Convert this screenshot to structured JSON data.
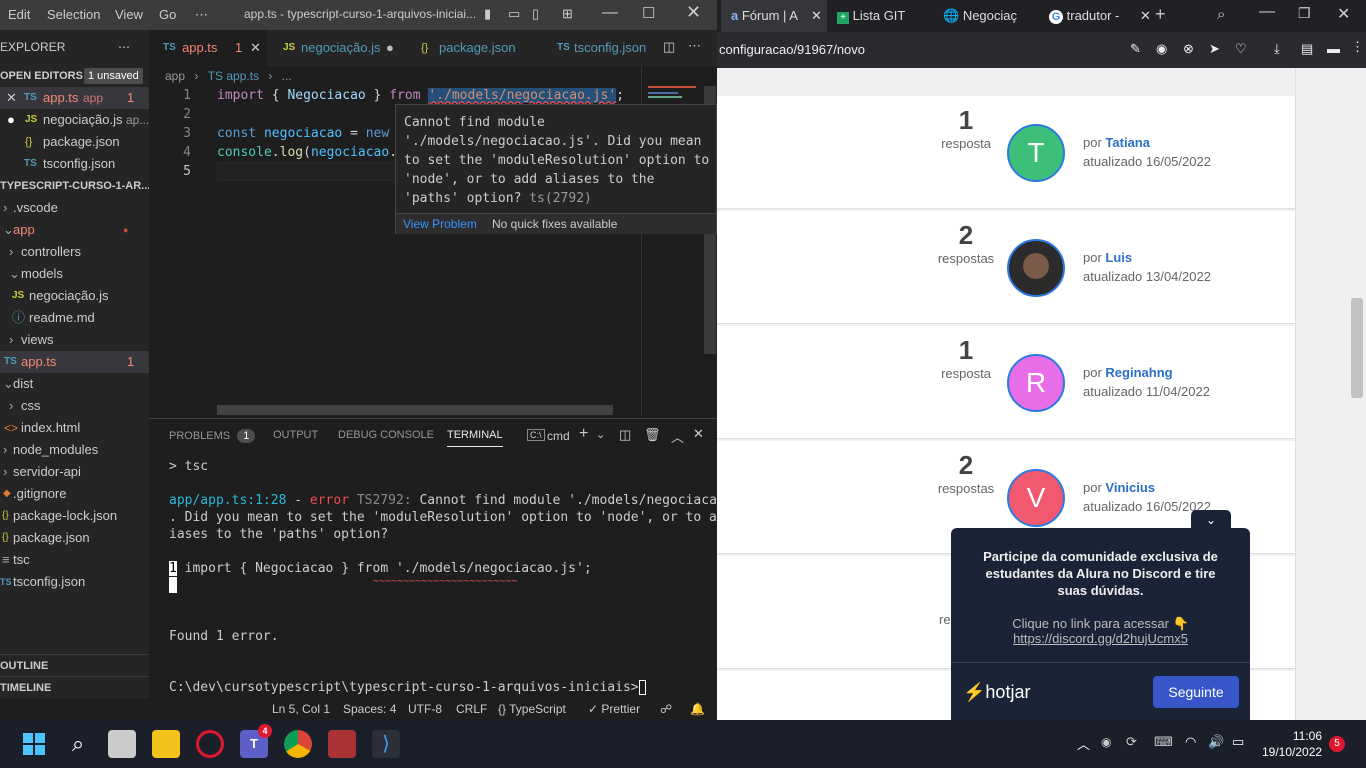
{
  "vscode": {
    "menu": [
      "Edit",
      "Selection",
      "View",
      "Go",
      "⋯"
    ],
    "window_title": "app.ts - typescript-curso-1-arquivos-iniciai...",
    "explorer_title": "EXPLORER",
    "open_editors": {
      "label": "OPEN EDITORS",
      "badge": "1 unsaved",
      "items": [
        {
          "icon": "TS",
          "name": "app.ts",
          "extra": "app",
          "count": "1"
        },
        {
          "icon": "JS",
          "name": "negociação.js",
          "extra": "ap..."
        },
        {
          "icon": "{}",
          "name": "package.json"
        },
        {
          "icon": "TS",
          "name": "tsconfig.json"
        }
      ]
    },
    "project_label": "TYPESCRIPT-CURSO-1-AR...",
    "tree": [
      {
        "name": ".vscode",
        "icon": "chevron-right"
      },
      {
        "name": "app",
        "icon": "chevron-down",
        "dot": true
      },
      {
        "name": "controllers",
        "icon": "chevron-right"
      },
      {
        "name": "models",
        "icon": "chevron-down"
      },
      {
        "name": "negociação.js",
        "icon": "JS"
      },
      {
        "name": "readme.md",
        "icon": "info"
      },
      {
        "name": "views",
        "icon": "chevron-right"
      },
      {
        "name": "app.ts",
        "icon": "TS",
        "count": "1"
      },
      {
        "name": "dist",
        "icon": "chevron-right"
      },
      {
        "name": "css",
        "icon": "chevron-right"
      },
      {
        "name": "index.html",
        "icon": "html"
      },
      {
        "name": "node_modules",
        "icon": "chevron-right"
      },
      {
        "name": "servidor-api",
        "icon": "chevron-right"
      },
      {
        "name": ".gitignore",
        "icon": "git"
      },
      {
        "name": "package-lock.json",
        "icon": "{}"
      },
      {
        "name": "package.json",
        "icon": "{}"
      },
      {
        "name": "tsc",
        "icon": "file"
      },
      {
        "name": "tsconfig.json",
        "icon": "TS"
      }
    ],
    "outline": "OUTLINE",
    "timeline": "TIMELINE",
    "tabs": [
      {
        "icon": "TS",
        "name": "app.ts",
        "count": "1"
      },
      {
        "icon": "JS",
        "name": "negociação.js"
      },
      {
        "icon": "{}",
        "name": "package.json"
      },
      {
        "icon": "TS",
        "name": "tsconfig.json"
      }
    ],
    "breadcrumb": [
      "app",
      "›",
      "TS app.ts",
      "›",
      "..."
    ],
    "code": [
      {
        "n": "1",
        "text": "import { Negociacao } from './models/negociacao.js';"
      },
      {
        "n": "2",
        "text": ""
      },
      {
        "n": "3",
        "text": "const negociacao = new"
      },
      {
        "n": "4",
        "text": "console.log(negociacao."
      },
      {
        "n": "5",
        "text": ""
      }
    ],
    "hover": {
      "message": "Cannot find module\n'./models/negociacao.js'. Did you mean\nto set the 'moduleResolution' option to\n'node', or to add aliases to the\n'paths' option?",
      "code": "ts(2792)",
      "view_problem": "View Problem",
      "no_fix": "No quick fixes available"
    },
    "panel_tabs": [
      "PROBLEMS",
      "OUTPUT",
      "DEBUG CONSOLE",
      "TERMINAL"
    ],
    "problems_count": "1",
    "terminal_shell": "cmd",
    "terminal": {
      "l1": "> tsc",
      "err_path": "app/app.ts:1:28",
      "err_sep": " - ",
      "err_word": "error",
      "err_code": "TS2792:",
      "err_msg1": " Cannot find module './models/negociacao.js'",
      "err_msg2": ". Did you mean to set the 'moduleResolution' option to 'node', or to add al",
      "err_msg3": "iases to the 'paths' option?",
      "src_num": "1",
      "src_line": "import { Negociacao } from './models/negociacao.js';",
      "squiggle": "~~~~~~~~~~~~~~~~~~~~~~~~",
      "found": "Found 1 error.",
      "prompt": "C:\\dev\\cursotypescript\\typescript-curso-1-arquivos-iniciais>"
    },
    "status": {
      "pos": "Ln 5, Col 1",
      "spaces": "Spaces: 4",
      "enc": "UTF-8",
      "eol": "CRLF",
      "lang": "{} TypeScript",
      "prettier": "✓ Prettier"
    }
  },
  "browser": {
    "tabs": [
      {
        "label": "Fórum | A",
        "icon": "a"
      },
      {
        "label": "Lista GIT",
        "icon": "+"
      },
      {
        "label": "Negociaç",
        "icon": "globe"
      },
      {
        "label": "tradutor -",
        "icon": "G"
      }
    ],
    "url": "configuracao/91967/novo",
    "posts": [
      {
        "count": "1",
        "word": "resposta",
        "initial": "T",
        "color": "#3dbf7a",
        "by": "por",
        "author": "Tatiana",
        "updated": "atualizado 16/05/2022"
      },
      {
        "count": "2",
        "word": "respostas",
        "initial": "",
        "color": "#333333",
        "by": "por",
        "author": "Luis",
        "updated": "atualizado 13/04/2022"
      },
      {
        "count": "1",
        "word": "resposta",
        "initial": "R",
        "color": "#e86ee8",
        "by": "por",
        "author": "Reginahng",
        "updated": "atualizado 11/04/2022"
      },
      {
        "count": "2",
        "word": "respostas",
        "initial": "V",
        "color": "#f0596f",
        "by": "por",
        "author": "Vinicius",
        "updated": "atualizado 16/05/2022"
      }
    ],
    "partial_text": "re",
    "hotjar": {
      "title": "Participe da comunidade exclusiva de estudantes da Alura no Discord e tire suas dúvidas.",
      "cta": "Clique no link para acessar 👇",
      "link": "https://discord.gg/d2hujUcmx5",
      "brand": "hotjar",
      "button": "Seguinte"
    }
  },
  "taskbar": {
    "time": "11:06",
    "date": "19/10/2022",
    "teams_badge": "4",
    "notif_badge": "5"
  }
}
